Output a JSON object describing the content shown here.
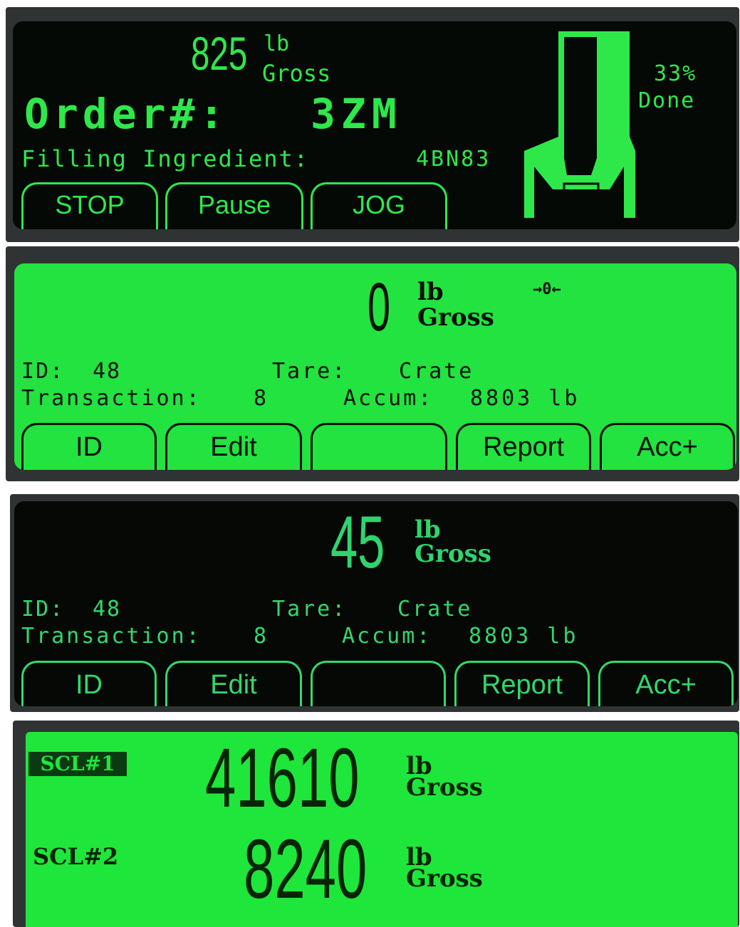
{
  "panel1": {
    "weight": {
      "value": "825",
      "unit": "lb",
      "mode": "Gross"
    },
    "order_label": "Order#:",
    "order_value": "3ZM",
    "ingredient_label": "Filling Ingredient:",
    "ingredient_value": "4BN83",
    "progress": {
      "percent_text": "33%",
      "done_label": "Done",
      "fraction": 0.33
    },
    "softkeys": [
      "STOP",
      "Pause",
      "JOG"
    ]
  },
  "panel2": {
    "weight": {
      "value": "0",
      "unit": "lb",
      "mode": "Gross"
    },
    "zero_indicator": "→0←",
    "id_label": "ID:",
    "id_value": "48",
    "tare_label": "Tare:",
    "tare_value": "Crate",
    "transaction_label": "Transaction:",
    "transaction_value": "8",
    "accum_label": "Accum:",
    "accum_value": "8803 lb",
    "softkeys": [
      "ID",
      "Edit",
      "",
      "Report",
      "Acc+"
    ]
  },
  "panel3": {
    "weight": {
      "value": "45",
      "unit": "lb",
      "mode": "Gross"
    },
    "id_label": "ID:",
    "id_value": "48",
    "tare_label": "Tare:",
    "tare_value": "Crate",
    "transaction_label": "Transaction:",
    "transaction_value": "8",
    "accum_label": "Accum:",
    "accum_value": "8803 lb",
    "softkeys": [
      "ID",
      "Edit",
      "",
      "Report",
      "Acc+"
    ]
  },
  "panel4": {
    "scales": [
      {
        "label": "SCL#1",
        "value": "41610",
        "unit": "lb",
        "mode": "Gross",
        "selected": true
      },
      {
        "label": "SCL#2",
        "value": "8240",
        "unit": "lb",
        "mode": "Gross",
        "selected": false
      }
    ]
  },
  "colors": {
    "lcd_green": "#22e33f",
    "lcd_dark": "#050905",
    "segment_green": "#2ee84a",
    "bezel": "#2f3334"
  },
  "icons": {
    "hopper": "hopper-fill-icon",
    "zero": "center-of-zero-icon"
  }
}
